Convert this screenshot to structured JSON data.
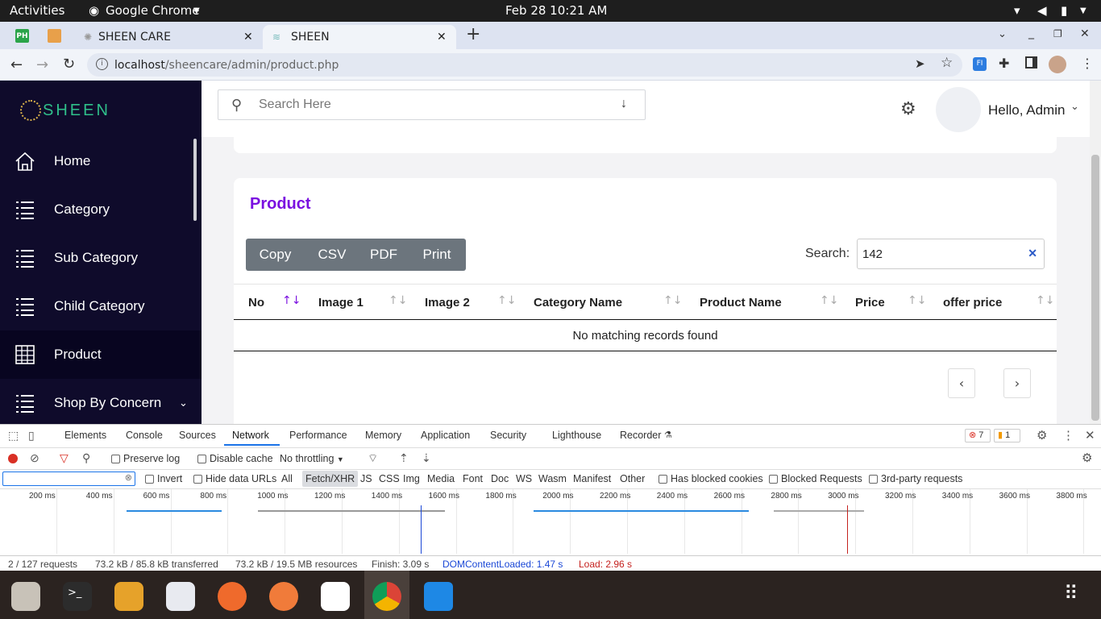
{
  "system": {
    "activities": "Activities",
    "app_name": "Google Chrome",
    "datetime": "Feb 28  10:21 AM"
  },
  "browser": {
    "tabs": [
      {
        "label": "SHEEN CARE"
      },
      {
        "label": "SHEEN"
      }
    ],
    "url_host": "localhost",
    "url_path": "/sheencare/admin/product.php"
  },
  "sidebar": {
    "logo_text": "SHEEN",
    "items": [
      {
        "label": "Home",
        "icon": "home-icon"
      },
      {
        "label": "Category",
        "icon": "list-icon"
      },
      {
        "label": "Sub Category",
        "icon": "list-icon"
      },
      {
        "label": "Child Category",
        "icon": "list-icon"
      },
      {
        "label": "Product",
        "icon": "grid-icon"
      },
      {
        "label": "Shop By Concern",
        "icon": "list-icon"
      }
    ]
  },
  "header": {
    "search_placeholder": "Search Here",
    "greeting": "Hello, Admin"
  },
  "product": {
    "title": "Product",
    "buttons": [
      "Copy",
      "CSV",
      "PDF",
      "Print"
    ],
    "search_label": "Search:",
    "search_value": "142",
    "columns": [
      "No",
      "Image 1",
      "Image 2",
      "Category Name",
      "Product Name",
      "Price",
      "offer price"
    ],
    "empty_message": "No matching records found"
  },
  "devtools": {
    "tabs": [
      "Elements",
      "Console",
      "Sources",
      "Network",
      "Performance",
      "Memory",
      "Application",
      "Security",
      "Lighthouse",
      "Recorder"
    ],
    "active_tab": "Network",
    "errors": "7",
    "warnings": "1",
    "preserve_log": "Preserve log",
    "disable_cache": "Disable cache",
    "throttling": "No throttling",
    "invert": "Invert",
    "hide_data_urls": "Hide data URLs",
    "filters": [
      "All",
      "Fetch/XHR",
      "JS",
      "CSS",
      "Img",
      "Media",
      "Font",
      "Doc",
      "WS",
      "Wasm",
      "Manifest",
      "Other"
    ],
    "has_blocked_cookies": "Has blocked cookies",
    "blocked_requests": "Blocked Requests",
    "third_party": "3rd-party requests",
    "ticks": [
      "200 ms",
      "400 ms",
      "600 ms",
      "800 ms",
      "1000 ms",
      "1200 ms",
      "1400 ms",
      "1600 ms",
      "1800 ms",
      "2000 ms",
      "2200 ms",
      "2400 ms",
      "2600 ms",
      "2800 ms",
      "3000 ms",
      "3200 ms",
      "3400 ms",
      "3600 ms",
      "3800 ms"
    ],
    "status": {
      "requests": "2 / 127 requests",
      "transferred": "73.2 kB / 85.8 kB transferred",
      "resources": "73.2 kB / 19.5 MB resources",
      "finish": "Finish: 3.09 s",
      "dom": "DOMContentLoaded: 1.47 s",
      "load": "Load: 2.96 s"
    },
    "colors": {
      "dom": "#1a47d6",
      "load": "#c5221f"
    }
  }
}
